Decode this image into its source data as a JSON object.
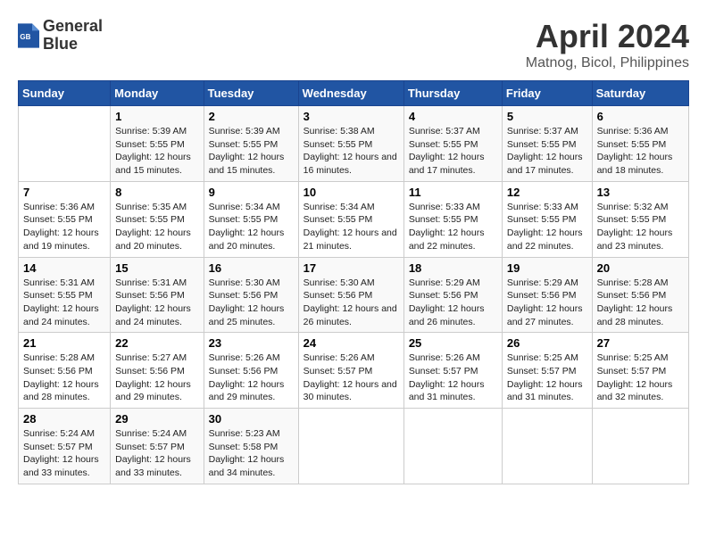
{
  "logo": {
    "line1": "General",
    "line2": "Blue"
  },
  "title": "April 2024",
  "subtitle": "Matnog, Bicol, Philippines",
  "headers": [
    "Sunday",
    "Monday",
    "Tuesday",
    "Wednesday",
    "Thursday",
    "Friday",
    "Saturday"
  ],
  "weeks": [
    [
      {
        "num": "",
        "sunrise": "",
        "sunset": "",
        "daylight": ""
      },
      {
        "num": "1",
        "sunrise": "Sunrise: 5:39 AM",
        "sunset": "Sunset: 5:55 PM",
        "daylight": "Daylight: 12 hours and 15 minutes."
      },
      {
        "num": "2",
        "sunrise": "Sunrise: 5:39 AM",
        "sunset": "Sunset: 5:55 PM",
        "daylight": "Daylight: 12 hours and 15 minutes."
      },
      {
        "num": "3",
        "sunrise": "Sunrise: 5:38 AM",
        "sunset": "Sunset: 5:55 PM",
        "daylight": "Daylight: 12 hours and 16 minutes."
      },
      {
        "num": "4",
        "sunrise": "Sunrise: 5:37 AM",
        "sunset": "Sunset: 5:55 PM",
        "daylight": "Daylight: 12 hours and 17 minutes."
      },
      {
        "num": "5",
        "sunrise": "Sunrise: 5:37 AM",
        "sunset": "Sunset: 5:55 PM",
        "daylight": "Daylight: 12 hours and 17 minutes."
      },
      {
        "num": "6",
        "sunrise": "Sunrise: 5:36 AM",
        "sunset": "Sunset: 5:55 PM",
        "daylight": "Daylight: 12 hours and 18 minutes."
      }
    ],
    [
      {
        "num": "7",
        "sunrise": "Sunrise: 5:36 AM",
        "sunset": "Sunset: 5:55 PM",
        "daylight": "Daylight: 12 hours and 19 minutes."
      },
      {
        "num": "8",
        "sunrise": "Sunrise: 5:35 AM",
        "sunset": "Sunset: 5:55 PM",
        "daylight": "Daylight: 12 hours and 20 minutes."
      },
      {
        "num": "9",
        "sunrise": "Sunrise: 5:34 AM",
        "sunset": "Sunset: 5:55 PM",
        "daylight": "Daylight: 12 hours and 20 minutes."
      },
      {
        "num": "10",
        "sunrise": "Sunrise: 5:34 AM",
        "sunset": "Sunset: 5:55 PM",
        "daylight": "Daylight: 12 hours and 21 minutes."
      },
      {
        "num": "11",
        "sunrise": "Sunrise: 5:33 AM",
        "sunset": "Sunset: 5:55 PM",
        "daylight": "Daylight: 12 hours and 22 minutes."
      },
      {
        "num": "12",
        "sunrise": "Sunrise: 5:33 AM",
        "sunset": "Sunset: 5:55 PM",
        "daylight": "Daylight: 12 hours and 22 minutes."
      },
      {
        "num": "13",
        "sunrise": "Sunrise: 5:32 AM",
        "sunset": "Sunset: 5:55 PM",
        "daylight": "Daylight: 12 hours and 23 minutes."
      }
    ],
    [
      {
        "num": "14",
        "sunrise": "Sunrise: 5:31 AM",
        "sunset": "Sunset: 5:55 PM",
        "daylight": "Daylight: 12 hours and 24 minutes."
      },
      {
        "num": "15",
        "sunrise": "Sunrise: 5:31 AM",
        "sunset": "Sunset: 5:56 PM",
        "daylight": "Daylight: 12 hours and 24 minutes."
      },
      {
        "num": "16",
        "sunrise": "Sunrise: 5:30 AM",
        "sunset": "Sunset: 5:56 PM",
        "daylight": "Daylight: 12 hours and 25 minutes."
      },
      {
        "num": "17",
        "sunrise": "Sunrise: 5:30 AM",
        "sunset": "Sunset: 5:56 PM",
        "daylight": "Daylight: 12 hours and 26 minutes."
      },
      {
        "num": "18",
        "sunrise": "Sunrise: 5:29 AM",
        "sunset": "Sunset: 5:56 PM",
        "daylight": "Daylight: 12 hours and 26 minutes."
      },
      {
        "num": "19",
        "sunrise": "Sunrise: 5:29 AM",
        "sunset": "Sunset: 5:56 PM",
        "daylight": "Daylight: 12 hours and 27 minutes."
      },
      {
        "num": "20",
        "sunrise": "Sunrise: 5:28 AM",
        "sunset": "Sunset: 5:56 PM",
        "daylight": "Daylight: 12 hours and 28 minutes."
      }
    ],
    [
      {
        "num": "21",
        "sunrise": "Sunrise: 5:28 AM",
        "sunset": "Sunset: 5:56 PM",
        "daylight": "Daylight: 12 hours and 28 minutes."
      },
      {
        "num": "22",
        "sunrise": "Sunrise: 5:27 AM",
        "sunset": "Sunset: 5:56 PM",
        "daylight": "Daylight: 12 hours and 29 minutes."
      },
      {
        "num": "23",
        "sunrise": "Sunrise: 5:26 AM",
        "sunset": "Sunset: 5:56 PM",
        "daylight": "Daylight: 12 hours and 29 minutes."
      },
      {
        "num": "24",
        "sunrise": "Sunrise: 5:26 AM",
        "sunset": "Sunset: 5:57 PM",
        "daylight": "Daylight: 12 hours and 30 minutes."
      },
      {
        "num": "25",
        "sunrise": "Sunrise: 5:26 AM",
        "sunset": "Sunset: 5:57 PM",
        "daylight": "Daylight: 12 hours and 31 minutes."
      },
      {
        "num": "26",
        "sunrise": "Sunrise: 5:25 AM",
        "sunset": "Sunset: 5:57 PM",
        "daylight": "Daylight: 12 hours and 31 minutes."
      },
      {
        "num": "27",
        "sunrise": "Sunrise: 5:25 AM",
        "sunset": "Sunset: 5:57 PM",
        "daylight": "Daylight: 12 hours and 32 minutes."
      }
    ],
    [
      {
        "num": "28",
        "sunrise": "Sunrise: 5:24 AM",
        "sunset": "Sunset: 5:57 PM",
        "daylight": "Daylight: 12 hours and 33 minutes."
      },
      {
        "num": "29",
        "sunrise": "Sunrise: 5:24 AM",
        "sunset": "Sunset: 5:57 PM",
        "daylight": "Daylight: 12 hours and 33 minutes."
      },
      {
        "num": "30",
        "sunrise": "Sunrise: 5:23 AM",
        "sunset": "Sunset: 5:58 PM",
        "daylight": "Daylight: 12 hours and 34 minutes."
      },
      {
        "num": "",
        "sunrise": "",
        "sunset": "",
        "daylight": ""
      },
      {
        "num": "",
        "sunrise": "",
        "sunset": "",
        "daylight": ""
      },
      {
        "num": "",
        "sunrise": "",
        "sunset": "",
        "daylight": ""
      },
      {
        "num": "",
        "sunrise": "",
        "sunset": "",
        "daylight": ""
      }
    ]
  ]
}
